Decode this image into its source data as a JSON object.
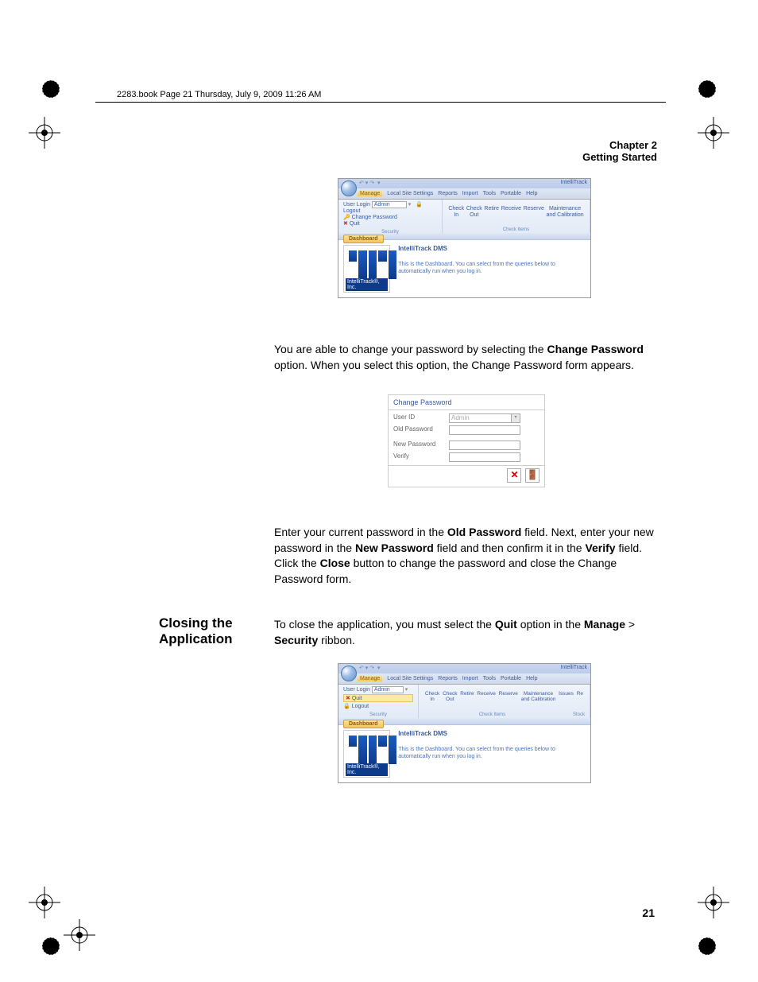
{
  "header": {
    "book_line": "2283.book  Page 21  Thursday, July 9, 2009  11:26 AM",
    "chapter_line1": "Chapter 2",
    "chapter_line2": "Getting Started"
  },
  "screenshot1": {
    "app_title": "IntelliTrack",
    "tabs": [
      "Manage",
      "Local Site Settings",
      "Reports",
      "Import",
      "Tools",
      "Portable",
      "Help"
    ],
    "security_group": {
      "user_login_label": "User Login",
      "user_login_value": "Admin",
      "change_password": "Change Password",
      "quit": "Quit",
      "logout": "Logout",
      "group_name": "Security"
    },
    "check_group": {
      "items": [
        "Check In",
        "Check Out",
        "Retire",
        "Receive",
        "Reserve",
        "Maintenance and Calibration"
      ],
      "group_name": "Check Items"
    },
    "dashboard_tab": "Dashboard",
    "dash_title": "IntelliTrack DMS",
    "dash_body": "This is the Dashboard. You can select from the queries below to automatically run when you log in.",
    "logo_label": "IntelliTrack®, Inc."
  },
  "paragraph1": {
    "pre": "You are able to change your password by selecting the ",
    "bold1": "Change Password",
    "post": " option. When you select this option, the Change Password form appears."
  },
  "change_password_form": {
    "title": "Change Password",
    "fields": {
      "user_id": "User ID",
      "user_id_value": "Admin",
      "old_password": "Old Password",
      "new_password": "New Password",
      "verify": "Verify"
    }
  },
  "paragraph2": {
    "t1": "Enter your current password in the ",
    "b1": "Old Password",
    "t2": " field. Next, enter your new password in the ",
    "b2": "New Password",
    "t3": " field and then confirm it in the ",
    "b3": "Verify",
    "t4": " field. Click the ",
    "b4": "Close",
    "t5": " button to change the password and close the Change Password form."
  },
  "section2_title": "Closing the Application",
  "paragraph3": {
    "t1": "To close the application, you must select the ",
    "b1": "Quit",
    "t2": " option in the ",
    "b2": "Manage",
    "t3": " > ",
    "b3": "Security",
    "t4": " ribbon."
  },
  "screenshot3": {
    "app_title": "IntelliTrack",
    "tabs": [
      "Manage",
      "Local Site Settings",
      "Reports",
      "Import",
      "Tools",
      "Portable",
      "Help"
    ],
    "security_group": {
      "user_login_label": "User Login",
      "user_login_value": "Admin",
      "quit": "Quit",
      "logout": "Logout",
      "group_name": "Security"
    },
    "check_group": {
      "items": [
        "Check In",
        "Check Out",
        "Retire",
        "Receive",
        "Reserve",
        "Maintenance and Calibration",
        "Issues",
        "Re"
      ],
      "group_name": "Check Items",
      "stock": "Stock"
    },
    "dashboard_tab": "Dashboard",
    "dash_title": "IntelliTrack DMS",
    "dash_body": "This is the Dashboard. You can select from the queries below to automatically run when you log in.",
    "logo_label": "IntelliTrack®, Inc."
  },
  "page_number": "21"
}
